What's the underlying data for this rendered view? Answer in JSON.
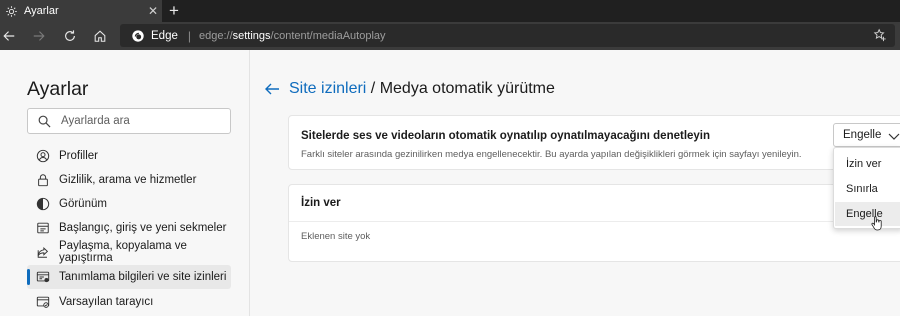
{
  "tab": {
    "title": "Ayarlar",
    "icon": "gear-icon",
    "close_icon": "close-icon",
    "new_tab_icon": "plus-icon"
  },
  "toolbar": {
    "back_icon": "back-arrow-icon",
    "forward_icon": "forward-arrow-icon",
    "refresh_icon": "refresh-icon",
    "home_icon": "home-icon",
    "favorites_icon": "add-favorite-icon"
  },
  "address": {
    "browser_label": "Edge",
    "separator": "|",
    "url_prefix": "edge://",
    "url_strong": "settings",
    "url_rest": "/content/mediaAutoplay"
  },
  "sidebar": {
    "title": "Ayarlar",
    "search_placeholder": "Ayarlarda ara",
    "items": [
      {
        "label": "Profiller",
        "icon": "profile-icon",
        "active": false
      },
      {
        "label": "Gizlilik, arama ve hizmetler",
        "icon": "lock-icon",
        "active": false
      },
      {
        "label": "Görünüm",
        "icon": "appearance-icon",
        "active": false
      },
      {
        "label": "Başlangıç, giriş ve yeni sekmeler",
        "icon": "home-tabs-icon",
        "active": false
      },
      {
        "label": "Paylaşma, kopyalama ve yapıştırma",
        "icon": "share-icon",
        "active": false
      },
      {
        "label": "Tanımlama bilgileri ve site izinleri",
        "icon": "site-permissions-icon",
        "active": true
      },
      {
        "label": "Varsayılan tarayıcı",
        "icon": "default-browser-icon",
        "active": false
      }
    ]
  },
  "main": {
    "breadcrumb_link": "Site izinleri",
    "breadcrumb_separator": " / ",
    "breadcrumb_current": "Medya otomatik yürütme",
    "autoplay_card": {
      "title": "Sitelerde ses ve videoların otomatik oynatılıp oynatılmayacağını denetleyin",
      "description": "Farklı siteler arasında gezinilirken medya engellenecektir. Bu ayarda yapılan değişiklikleri görmek için sayfayı yenileyin."
    },
    "select": {
      "value": "Engelle",
      "options": [
        "İzin ver",
        "Sınırla",
        "Engelle"
      ],
      "hovered": "Engelle"
    },
    "allow_card": {
      "title": "İzin ver",
      "empty_text": "Eklenen site yok"
    }
  },
  "colors": {
    "accent": "#0f6cbd",
    "chrome_dark": "#202020",
    "chrome_mid": "#3b3b3b",
    "page_bg": "#f7f7f7"
  }
}
